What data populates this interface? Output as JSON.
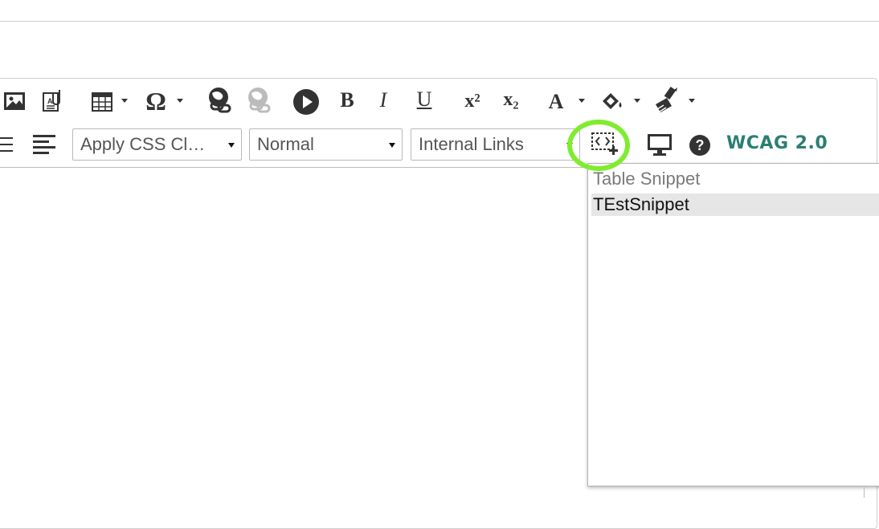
{
  "toolbar": {
    "bold_label": "B",
    "italic_label": "I",
    "underline_label": "U",
    "superscript_label": "x²",
    "subscript_label": "x₂",
    "text_color_label": "A",
    "omega_label": "Ω",
    "css_class_select": {
      "value": "Apply CSS Cl…"
    },
    "format_select": {
      "value": "Normal"
    },
    "links_select": {
      "value": "Internal Links"
    },
    "wcag_label": "WCAG 2.0"
  },
  "snippet_dropdown": {
    "title": "Table Snippet",
    "items": [
      {
        "label": "TEstSnippet"
      }
    ]
  },
  "annotation": {
    "ring_color": "#7fec2f"
  },
  "colors": {
    "wcag": "#2b7f72",
    "icons": "#333333",
    "highlight_item": "#e6e6e6"
  }
}
